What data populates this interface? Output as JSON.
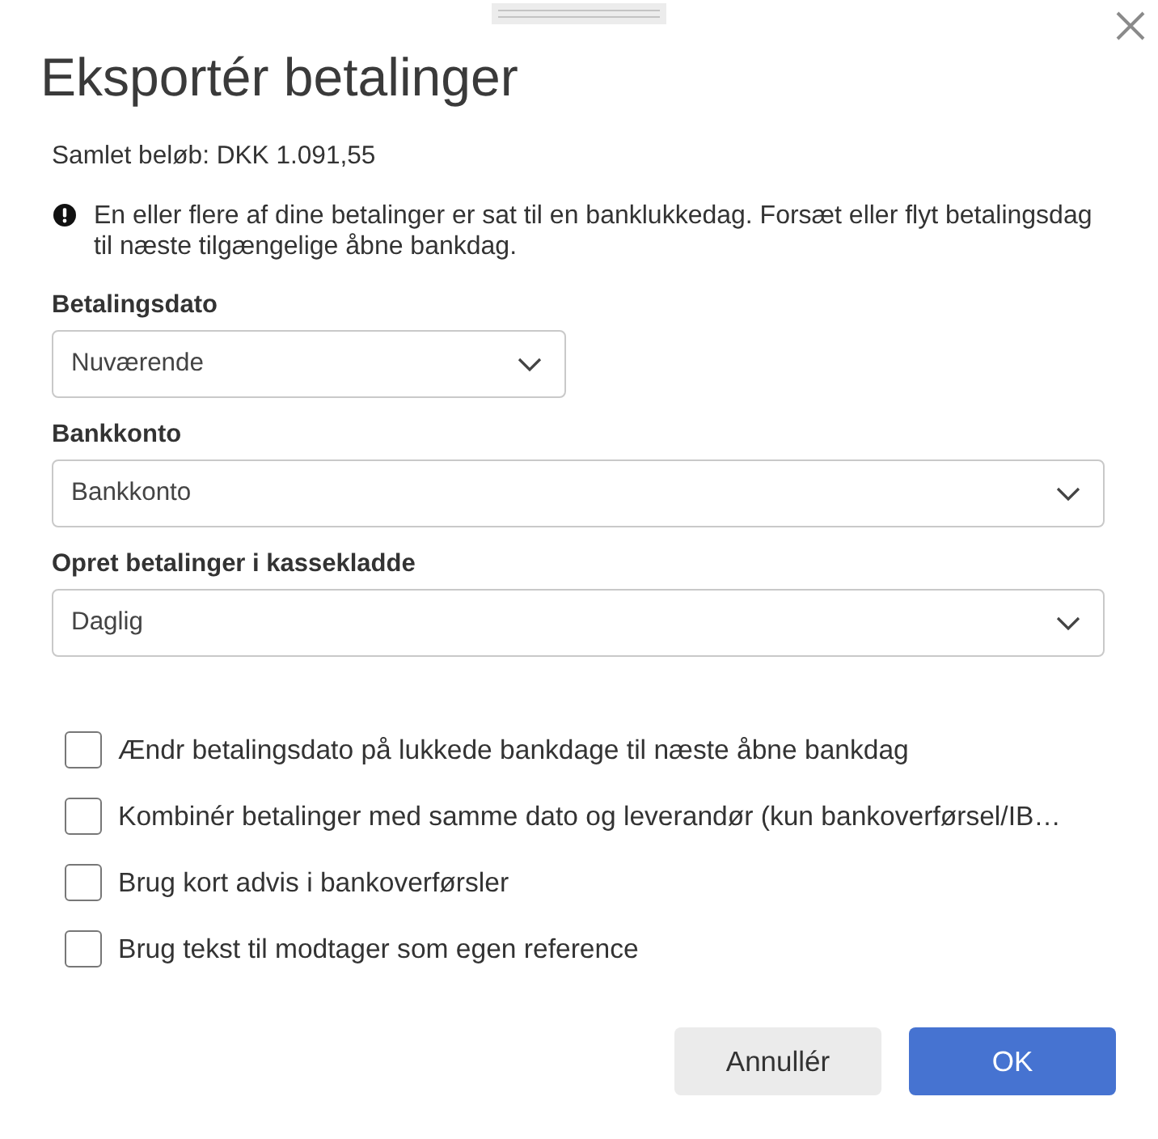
{
  "dialog": {
    "title": "Eksportér betalinger",
    "total": "Samlet beløb: DKK 1.091,55",
    "warning": "En eller flere af dine betalinger er sat til en banklukkedag. Forsæt eller flyt betalingsdag til næste tilgængelige åbne bankdag."
  },
  "fields": [
    {
      "label": "Betalingsdato",
      "value": "Nuværende"
    },
    {
      "label": "Bankkonto",
      "value": "Bankkonto"
    },
    {
      "label": "Opret betalinger i kassekladde",
      "value": "Daglig"
    }
  ],
  "checkboxes": [
    {
      "label": "Ændr betalingsdato på lukkede bankdage til næste åbne bankdag",
      "checked": false
    },
    {
      "label": "Kombinér betalinger med samme dato og leverandør (kun bankoverførsel/IB…",
      "checked": false
    },
    {
      "label": "Brug kort advis i bankoverførsler",
      "checked": false
    },
    {
      "label": "Brug tekst til modtager som egen reference",
      "checked": false
    }
  ],
  "buttons": [
    {
      "label": "Annullér",
      "kind": "secondary"
    },
    {
      "label": "OK",
      "kind": "primary"
    }
  ]
}
